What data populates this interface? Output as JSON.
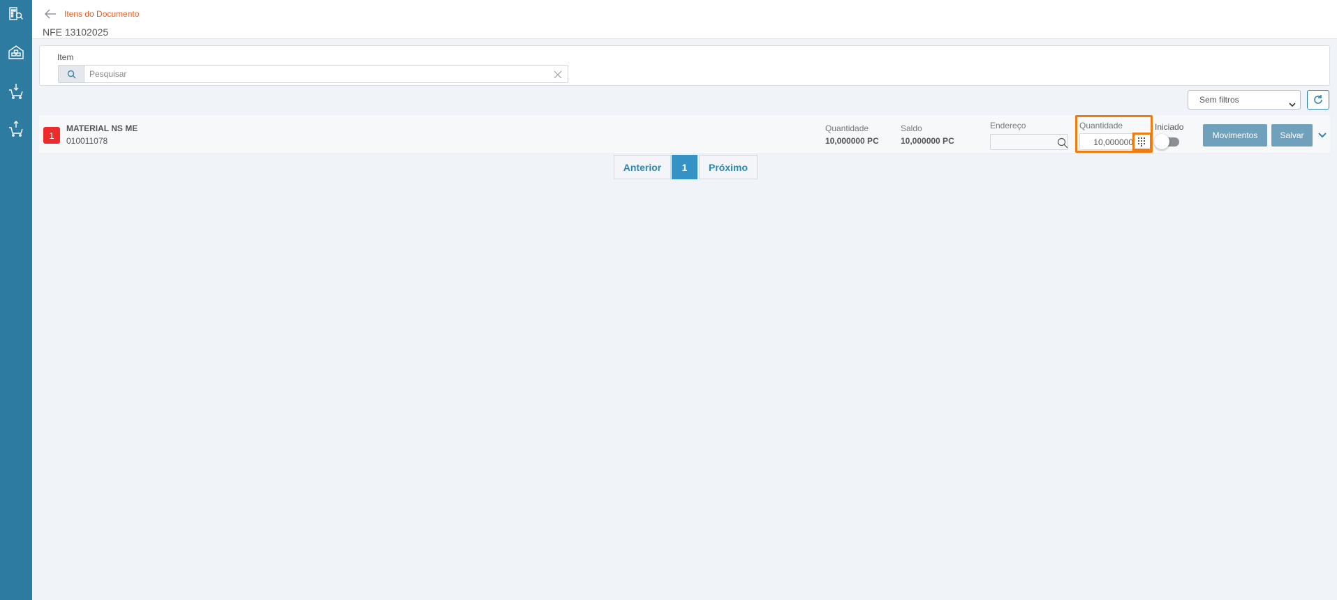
{
  "sidebar": {
    "items": [
      {
        "icon": "building-search-icon"
      },
      {
        "icon": "warehouse-icon"
      },
      {
        "icon": "basket-down-icon"
      },
      {
        "icon": "basket-up-icon"
      }
    ]
  },
  "header": {
    "breadcrumb": "Itens do Documento",
    "title": "NFE 13102025"
  },
  "search": {
    "label": "Item",
    "placeholder": "Pesquisar",
    "value": ""
  },
  "toolbar": {
    "filter_selected": "Sem filtros"
  },
  "items": [
    {
      "badge": "1",
      "name": "MATERIAL NS ME",
      "code": "010011078",
      "quantity_label": "Quantidade",
      "quantity_value": "10,000000 PC",
      "balance_label": "Saldo",
      "balance_value": "10,000000 PC",
      "address_label": "Endereço",
      "address_value": "",
      "qty_input_label": "Quantidade",
      "qty_input_value": "10,000000",
      "started_label": "Iniciado",
      "started": false,
      "movements_button": "Movimentos",
      "save_button": "Salvar"
    }
  ],
  "pagination": {
    "previous": "Anterior",
    "current": "1",
    "next": "Próximo"
  },
  "colors": {
    "sidebar": "#2e7ba1",
    "accent_orange": "#ea5a1d",
    "highlight": "#f07c0f",
    "badge_red": "#ee2b2b",
    "button": "#6fa1bd",
    "page_current": "#3592c4"
  }
}
